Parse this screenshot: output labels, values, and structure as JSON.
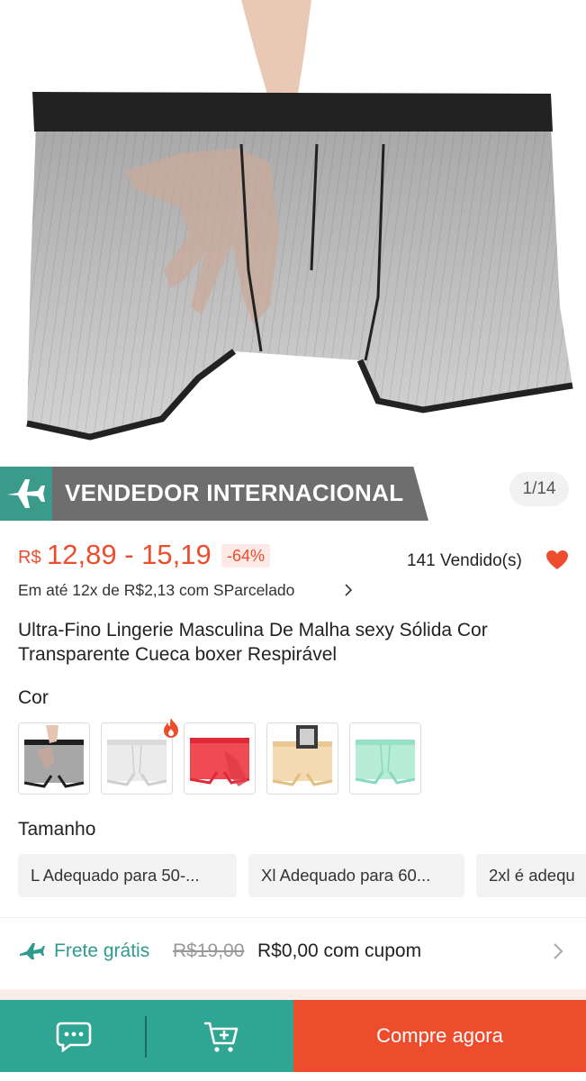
{
  "product_image": {
    "pager": "1/14"
  },
  "banner": {
    "label": "VENDEDOR INTERNACIONAL",
    "icon": "airplane-icon",
    "color": "#3a9b8a"
  },
  "price": {
    "currency": "R$",
    "range": "12,89 - 15,19",
    "discount": "-64%",
    "sold": "141 Vendido(s)",
    "color": "#ee4d2d"
  },
  "installments": "Em até 12x de R$2,13 com SParcelado",
  "title": "Ultra-Fino Lingerie Masculina De Malha sexy Sólida Cor Transparente Cueca boxer Respirável",
  "color_section": {
    "label": "Cor",
    "options": [
      "black",
      "white",
      "red",
      "beige",
      "mint"
    ]
  },
  "size_section": {
    "label": "Tamanho",
    "options": [
      "L Adequado para 50-...",
      "Xl Adequado para 60...",
      "2xl é adequ"
    ]
  },
  "shipping": {
    "free_label": "Frete grátis",
    "old_price": "R$19,00",
    "new_price": "R$0,00 com cupom"
  },
  "bottom_bar": {
    "chat_icon": "chat-icon",
    "cart_icon": "add-to-cart-icon",
    "buy_label": "Compre agora"
  }
}
